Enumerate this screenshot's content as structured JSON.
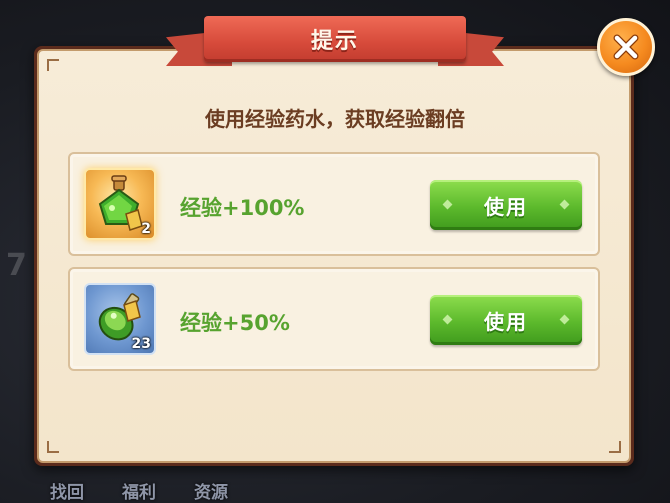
{
  "background": {
    "left_number": "7",
    "bottom_nav": [
      "找回",
      "福利",
      "资源"
    ]
  },
  "dialog": {
    "title": "提示",
    "subtitle": "使用经验药水，获取经验翻倍",
    "close_icon": "close-x-icon",
    "items": [
      {
        "icon": "green-potion-gold-frame-icon",
        "count": "2",
        "label": "经验+100%",
        "button_label": "使用"
      },
      {
        "icon": "green-potion-blue-frame-icon",
        "count": "23",
        "label": "经验+50%",
        "button_label": "使用"
      }
    ]
  },
  "colors": {
    "title_ribbon": "#d64a3a",
    "close_button": "#f58a1f",
    "item_label": "#57a32f",
    "use_button": "#5cb92c",
    "subtitle": "#6b3d22"
  }
}
